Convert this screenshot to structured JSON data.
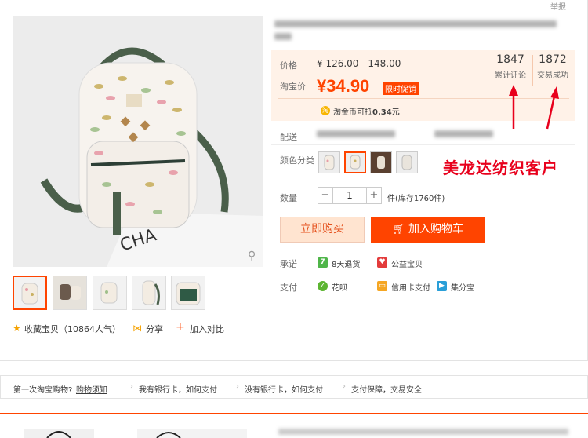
{
  "report": "举报",
  "pricing": {
    "price_label": "价格",
    "original_price": "¥ 126.00 - 148.00",
    "taobao_price_label": "淘宝价",
    "current_price": "¥34.90",
    "promo_tag": "限时促销",
    "coin_text": "淘金币可抵",
    "coin_value": "0.34元",
    "coin_icon": "淘",
    "stats": [
      {
        "value": "1847",
        "label": "累计评论"
      },
      {
        "value": "1872",
        "label": "交易成功"
      }
    ]
  },
  "shipping_label": "配送",
  "color_label": "颜色分类",
  "quantity": {
    "label": "数量",
    "value": "1",
    "minus": "−",
    "plus": "+",
    "stock": "件(库存1760件)"
  },
  "buttons": {
    "buy_now": "立即购买",
    "add_to_cart": "加入购物车",
    "cart_icon": "cart-icon"
  },
  "promise": {
    "label": "承诺",
    "items": [
      {
        "icon": "7",
        "text": "8天退货",
        "color": "#4fb549"
      },
      {
        "icon": "♥",
        "text": "公益宝贝",
        "color": "#e33b3b"
      }
    ]
  },
  "payment": {
    "label": "支付",
    "items": [
      {
        "icon": "✓",
        "text": "花呗",
        "color": "#5cb531"
      },
      {
        "icon": "▭",
        "text": "信用卡支付",
        "color": "#f5a623"
      },
      {
        "icon": "▶",
        "text": "集分宝",
        "color": "#2a9fd8"
      }
    ]
  },
  "annotation": "美龙达纺织客户",
  "actions": {
    "favorite": "收藏宝贝（10864人气）",
    "share": "分享",
    "compare": "加入对比"
  },
  "guide_bar": {
    "first_time": "第一次淘宝购物?",
    "first_time_link": "购物须知",
    "has_card": "我有银行卡，如何支付",
    "no_card": "没有银行卡，如何支付",
    "guarantee": "支付保障，交易安全"
  },
  "colors": {
    "accent": "#ff4400",
    "price_bg": "#fff2e8",
    "annotation": "#e8001c"
  }
}
